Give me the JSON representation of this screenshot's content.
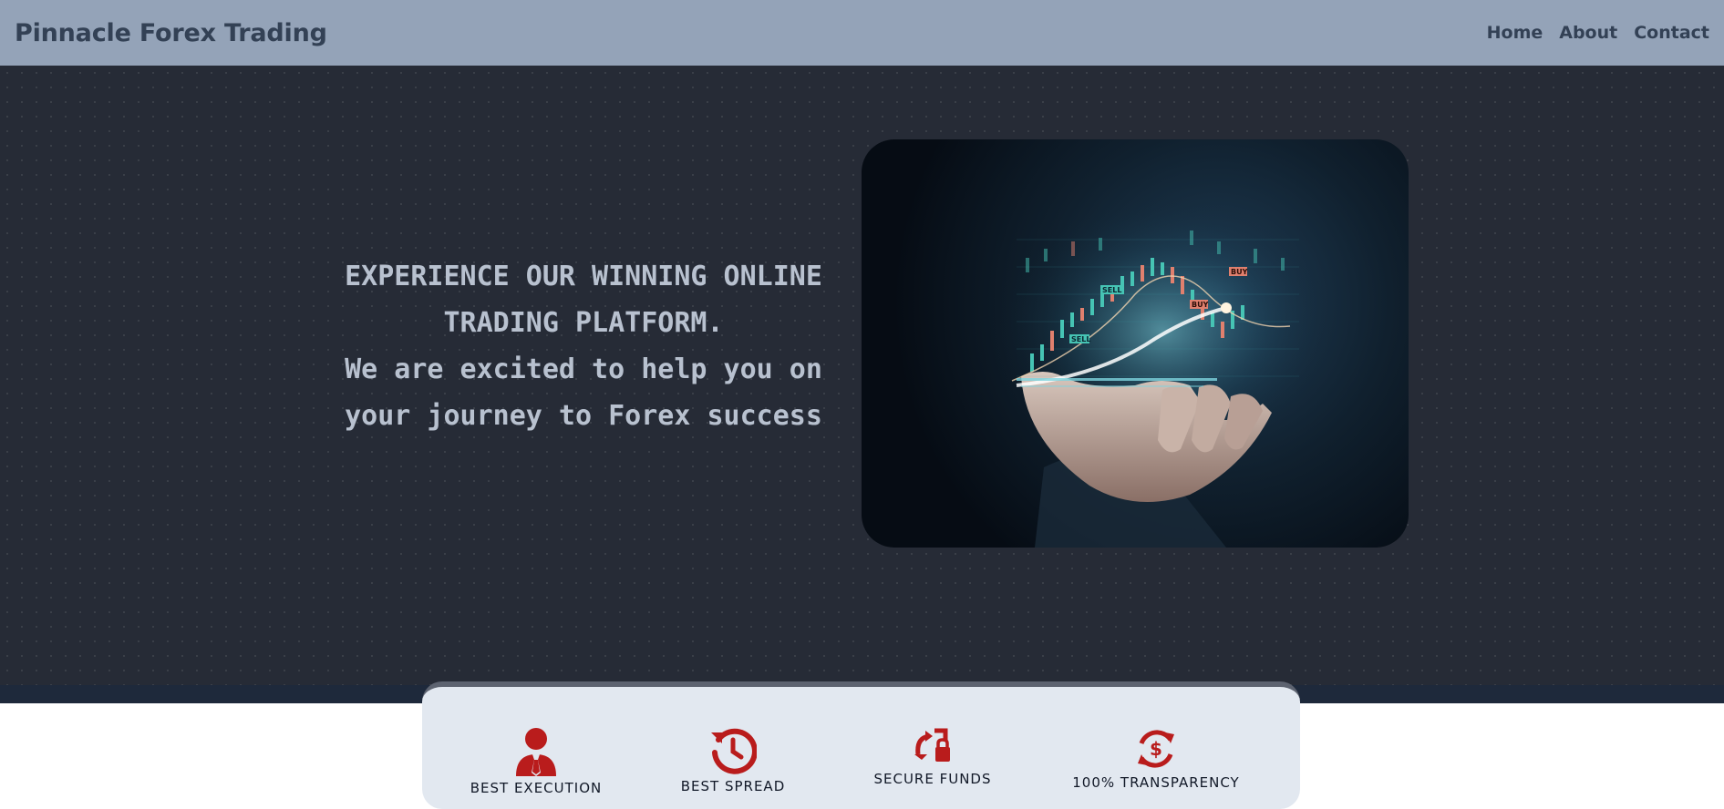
{
  "navbar": {
    "brand": "Pinnacle Forex Trading",
    "links": [
      "Home",
      "About",
      "Contact"
    ]
  },
  "hero": {
    "headline_line1": "EXPERIENCE OUR WINNING ONLINE",
    "headline_line2": "TRADING PLATFORM.",
    "sub_line1": "We are excited to help you on",
    "sub_line2": "your journey to Forex success",
    "image_tags": {
      "sell_1": "SELL",
      "sell_2": "SELL",
      "buy_1": "BUY",
      "buy_2": "BUY"
    }
  },
  "features": [
    {
      "label": "BEST EXECUTION",
      "icon": "user-tie-icon"
    },
    {
      "label": "BEST SPREAD",
      "icon": "clock-rotate-icon"
    },
    {
      "label": "SECURE FUNDS",
      "icon": "secure-funds-icon"
    },
    {
      "label": "100% TRANSPARENCY",
      "icon": "dollar-refresh-icon"
    }
  ],
  "colors": {
    "navbar_bg": "#94a3b8",
    "hero_bg": "#262b36",
    "accent_red": "#b91c1c",
    "card_bg": "#e2e8f0"
  }
}
